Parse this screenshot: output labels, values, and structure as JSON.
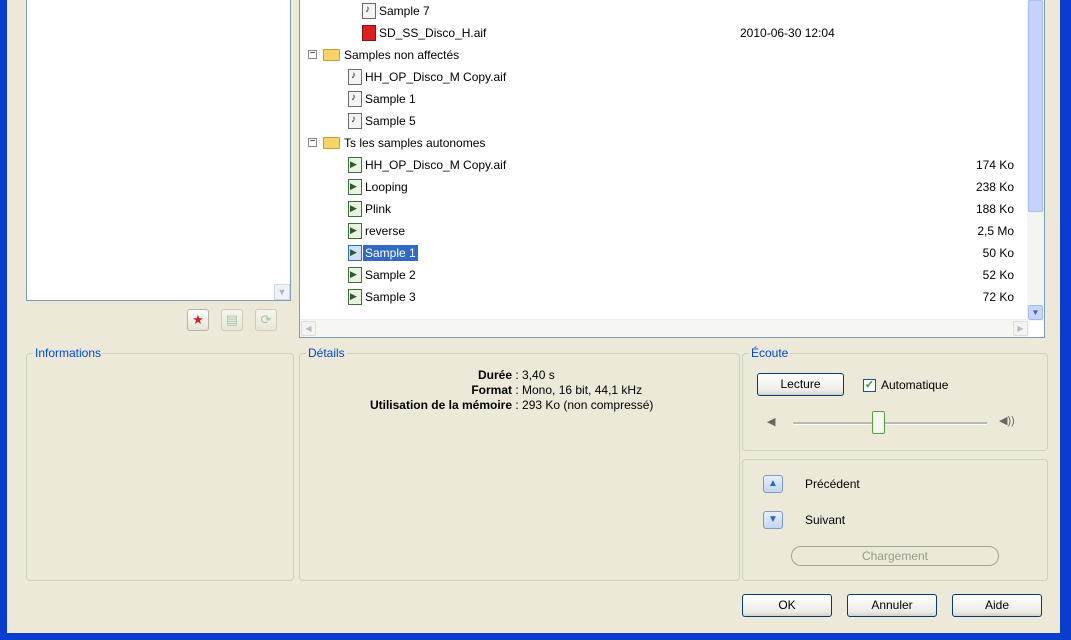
{
  "tree": {
    "items": [
      {
        "label": "Sample 7",
        "date": "",
        "size": ""
      },
      {
        "label": "SD_SS_Disco_H.aif",
        "date": "2010-06-30 12:04",
        "size": ""
      },
      {
        "label": "Samples non affectés",
        "toggle": "−"
      },
      {
        "label": "HH_OP_Disco_M Copy.aif"
      },
      {
        "label": "Sample 1"
      },
      {
        "label": "Sample 5"
      },
      {
        "label": "Ts les samples autonomes",
        "toggle": "−"
      },
      {
        "label": "HH_OP_Disco_M Copy.aif",
        "size": "174 Ko"
      },
      {
        "label": "Looping",
        "size": "238 Ko"
      },
      {
        "label": "Plink",
        "size": "188 Ko"
      },
      {
        "label": "reverse",
        "size": "2,5 Mo"
      },
      {
        "label": "Sample 1",
        "size": "50 Ko",
        "selected": true
      },
      {
        "label": "Sample 2",
        "size": "52 Ko"
      },
      {
        "label": "Sample 3",
        "size": "72 Ko"
      }
    ]
  },
  "informations": {
    "title": "Informations"
  },
  "details": {
    "title": "Détails",
    "rows": [
      {
        "label": "Durée",
        "value": "3,40 s"
      },
      {
        "label": "Format",
        "value": "Mono, 16 bit, 44,1 kHz"
      },
      {
        "label": "Utilisation de la mémoire",
        "value": "293 Ko (non compressé)"
      }
    ]
  },
  "ecoute": {
    "title": "Écoute",
    "play_label": "Lecture",
    "auto_label": "Automatique",
    "auto_checked": true,
    "volume": 0.45
  },
  "nav": {
    "previous_label": "Précédent",
    "next_label": "Suivant",
    "loading_label": "Chargement"
  },
  "footer": {
    "ok_label": "OK",
    "cancel_label": "Annuler",
    "help_label": "Aide"
  },
  "colors": {
    "title_blue": "#0046d5",
    "selection": "#316ac5",
    "frame": "#0a3ccd"
  }
}
